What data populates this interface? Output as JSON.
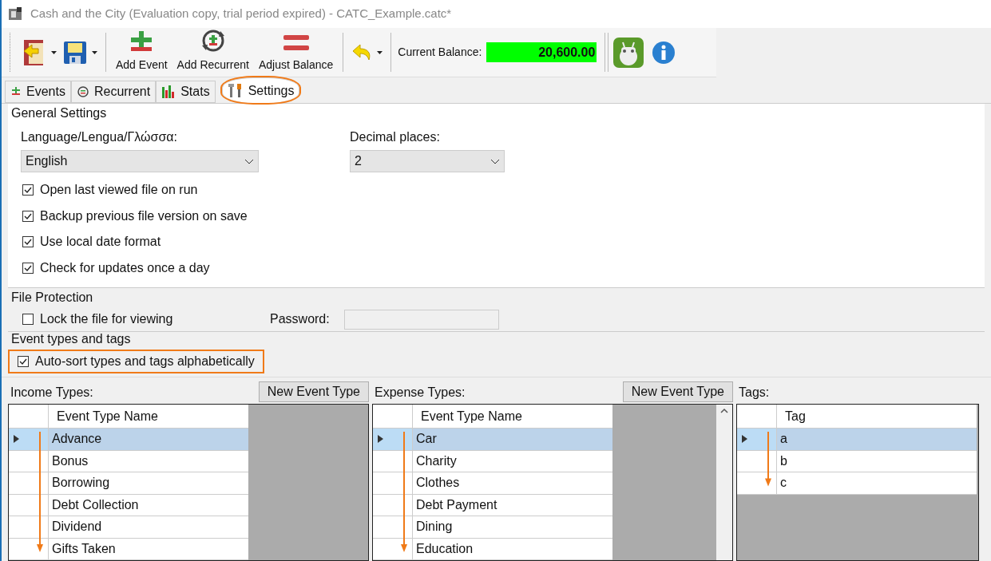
{
  "window": {
    "title": "Cash and the City (Evaluation copy, trial period expired) - CATC_Example.catc*"
  },
  "toolbar": {
    "buttons": [
      {
        "kind": "open"
      },
      {
        "kind": "save"
      },
      {
        "kind": "add",
        "label": "Add Event"
      },
      {
        "kind": "recurrent",
        "label": "Add Recurrent"
      },
      {
        "kind": "adjust",
        "label": "Adjust Balance"
      },
      {
        "kind": "undo"
      }
    ],
    "balance_label": "Current Balance:",
    "balance_value": "20,600.00"
  },
  "tabs": [
    {
      "label": "Events",
      "kind": "events",
      "selected": false,
      "highlighted": false
    },
    {
      "label": "Recurrent",
      "kind": "recurrent",
      "selected": false,
      "highlighted": false
    },
    {
      "label": "Stats",
      "kind": "stats",
      "selected": false,
      "highlighted": false
    },
    {
      "label": "Settings",
      "kind": "settings",
      "selected": true,
      "highlighted": true
    }
  ],
  "general_settings": {
    "title": "General Settings",
    "language_label": "Language/Lengua/Γλώσσα:",
    "language_value": "English",
    "decimal_label": "Decimal places:",
    "decimal_value": "2",
    "options": [
      {
        "label": "Open last viewed file on run",
        "checked": true
      },
      {
        "label": "Backup previous file version on save",
        "checked": true
      },
      {
        "label": "Use local date format",
        "checked": true
      },
      {
        "label": "Check for updates once a day",
        "checked": true
      }
    ]
  },
  "file_protection": {
    "title": "File Protection",
    "lock": {
      "label": "Lock the file for viewing",
      "checked": false
    },
    "password_label": "Password:"
  },
  "event_types": {
    "title": "Event types and tags",
    "auto_sort": {
      "label": "Auto-sort types and tags alphabetically",
      "checked": true,
      "highlighted": true
    }
  },
  "grids": [
    {
      "label": "Income Types:",
      "button": "New Event Type",
      "column": "Event Type Name",
      "rows": [
        {
          "text": "Advance",
          "selected": true
        },
        {
          "text": "Bonus",
          "selected": false
        },
        {
          "text": "Borrowing",
          "selected": false
        },
        {
          "text": "Debt Collection",
          "selected": false
        },
        {
          "text": "Dividend",
          "selected": false
        },
        {
          "text": "Gifts Taken",
          "selected": false
        }
      ]
    },
    {
      "label": "Expense Types:",
      "button": "New Event Type",
      "column": "Event Type Name",
      "rows": [
        {
          "text": "Car",
          "selected": true
        },
        {
          "text": "Charity",
          "selected": false
        },
        {
          "text": "Clothes",
          "selected": false
        },
        {
          "text": "Debt Payment",
          "selected": false
        },
        {
          "text": "Dining",
          "selected": false
        },
        {
          "text": "Education",
          "selected": false
        }
      ]
    },
    {
      "label": "Tags:",
      "column": "Tag",
      "rows": [
        {
          "text": "a",
          "selected": true
        },
        {
          "text": "b",
          "selected": false
        },
        {
          "text": "c",
          "selected": false
        }
      ]
    }
  ]
}
